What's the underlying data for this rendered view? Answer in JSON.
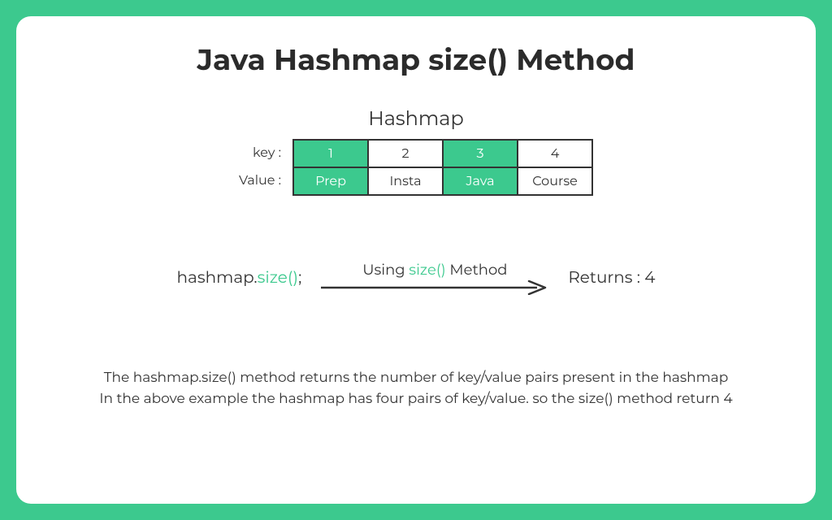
{
  "title": "Java Hashmap size() Method",
  "hashmap": {
    "heading": "Hashmap",
    "key_label": "key :",
    "value_label": "Value :",
    "entries": [
      {
        "key": "1",
        "value": "Prep",
        "highlight": true
      },
      {
        "key": "2",
        "value": "Insta",
        "highlight": false
      },
      {
        "key": "3",
        "value": "Java",
        "highlight": true
      },
      {
        "key": "4",
        "value": "Course",
        "highlight": false
      }
    ]
  },
  "flow": {
    "call_prefix": "hashmap.",
    "call_method": "size()",
    "call_suffix": ";",
    "caption_prefix": "Using ",
    "caption_method": "size()",
    "caption_suffix": " Method",
    "returns": "Returns : 4"
  },
  "description": {
    "line1": "The hashmap.size() method returns the number of key/value pairs present in the hashmap",
    "line2": "In the above example the hashmap has four pairs of key/value. so the size() method return 4"
  },
  "colors": {
    "accent": "#3cc98e"
  }
}
